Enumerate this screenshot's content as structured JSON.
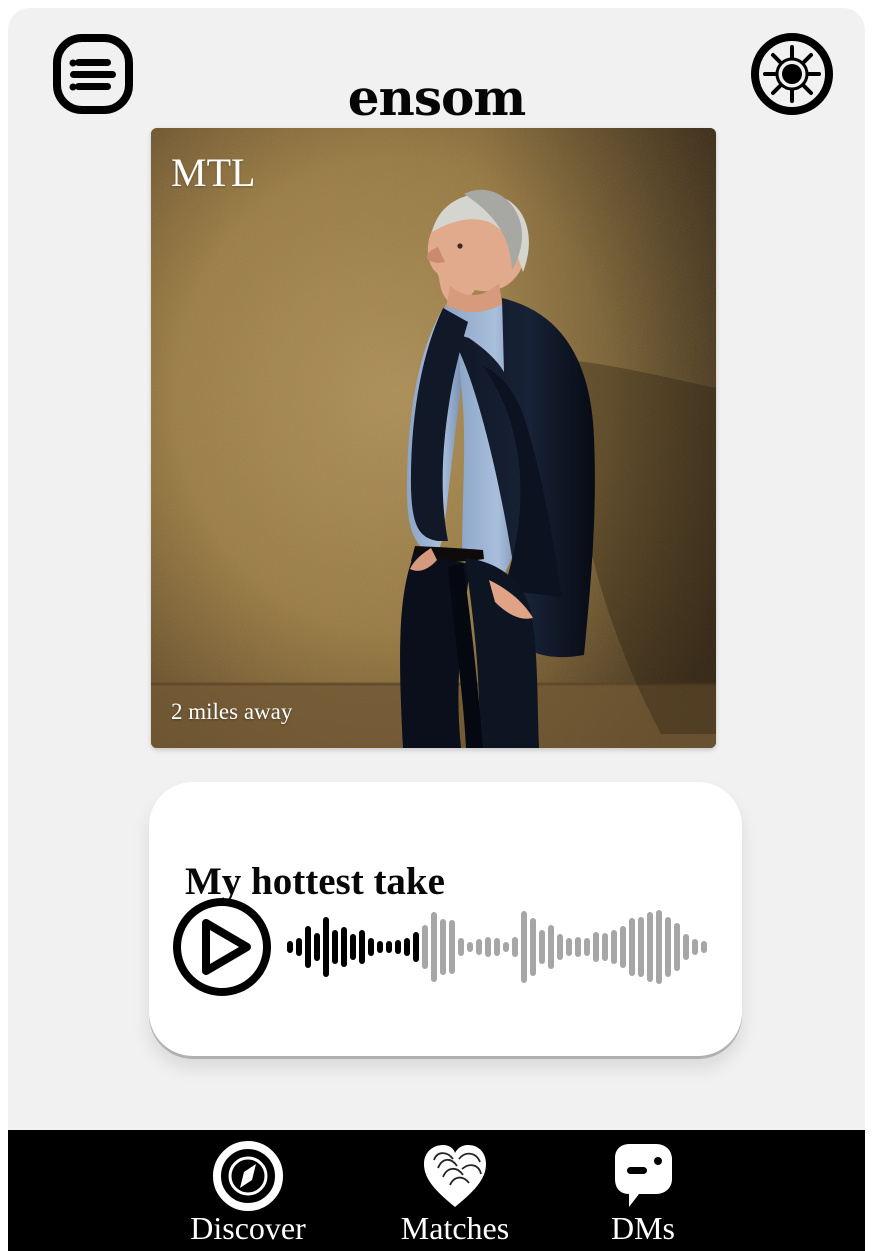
{
  "app": {
    "brand": "ensom"
  },
  "header": {
    "left_icon": "menu-list-icon",
    "right_icon": "sun-icon"
  },
  "profile": {
    "name": "MTL",
    "distance": "2 miles away",
    "photo_description_icon": "profile-photo"
  },
  "voice_prompt": {
    "title": "My hottest take",
    "play_icon": "play-icon",
    "waveform_icon": "waveform-icon",
    "playback_progress": 0.31
  },
  "bottom_nav": {
    "items": [
      {
        "label": "Discover",
        "icon": "compass-icon"
      },
      {
        "label": "Matches",
        "icon": "heart-stack-icon"
      },
      {
        "label": "DMs",
        "icon": "message-bubble-icon"
      }
    ]
  },
  "colors": {
    "background": "#f1f1f1",
    "text": "#050505",
    "waveform_active": "#000000",
    "waveform_inactive": "#a6a6a6",
    "nav_background": "#000000",
    "nav_text": "#ffffff"
  }
}
